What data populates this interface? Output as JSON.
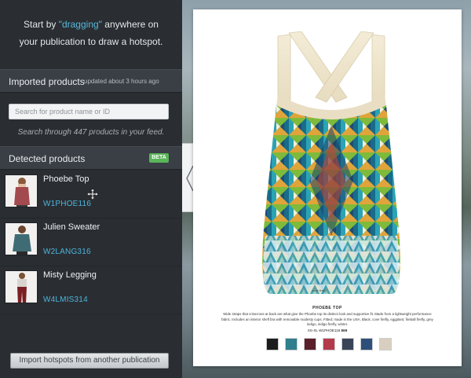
{
  "hint": {
    "line1_before": "Start by ",
    "line1_highlight": "\"dragging\"",
    "line1_after": " anywhere on",
    "line2": "your publication to draw a hotspot."
  },
  "imported": {
    "title": "Imported products",
    "updated": "updated about 3 hours ago",
    "search_placeholder": "Search for product name or ID",
    "search_note": "Search through 447 products in your feed."
  },
  "detected": {
    "title": "Detected products",
    "badge": "BETA",
    "products": [
      {
        "name": "Phoebe Top",
        "sku": "W1PHOE116",
        "thumb_color": "#a34a4f"
      },
      {
        "name": "Julien Sweater",
        "sku": "W2LANG316",
        "thumb_color": "#3f6c74"
      },
      {
        "name": "Misty Legging",
        "sku": "W4LMIS314",
        "thumb_color": "#7a1f24"
      }
    ]
  },
  "import_button": "Import hotspots from another publication",
  "publication": {
    "color_caption": "cove firefly",
    "title": "PHOEBE TOP",
    "description": "Wide straps that crisscross at back are what give the Phoebe top its distinct look and supportive fit. Made from a lightweight performance fabric. Includes an interior shelf bra with removable modesty cups. Fitted; made in the USA. Black, cove firefly, eggplant, fireball firefly, grey indigo, indigo firefly, winter.",
    "sizes_sku": "XS-XL  W1PHOE116",
    "price": "$69",
    "swatch_colors": [
      "#1c1c1e",
      "#2f7f8c",
      "#5a1f2a",
      "#b33a4a",
      "#3a4458",
      "#2e4f7a",
      "#d9cfc0"
    ]
  },
  "colors": {
    "accent": "#58b8dd",
    "sku": "#4db4dc",
    "beta": "#5bb55a"
  }
}
